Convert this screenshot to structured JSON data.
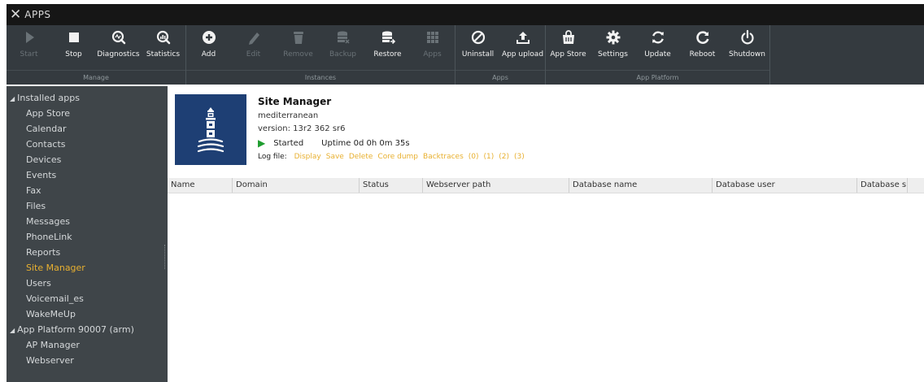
{
  "window": {
    "title": "APPS"
  },
  "toolbar": {
    "groups": [
      {
        "label": "Manage",
        "buttons": [
          {
            "label": "Start",
            "icon": "play-icon",
            "disabled": true
          },
          {
            "label": "Stop",
            "icon": "stop-icon",
            "disabled": false
          },
          {
            "label": "Diagnostics",
            "icon": "diagnostics-icon",
            "disabled": false
          },
          {
            "label": "Statistics",
            "icon": "statistics-icon",
            "disabled": false
          }
        ]
      },
      {
        "label": "Instances",
        "buttons": [
          {
            "label": "Add",
            "icon": "add-icon",
            "disabled": false
          },
          {
            "label": "Edit",
            "icon": "edit-icon",
            "disabled": true
          },
          {
            "label": "Remove",
            "icon": "trash-icon",
            "disabled": true
          },
          {
            "label": "Backup",
            "icon": "backup-icon",
            "disabled": true
          },
          {
            "label": "Restore",
            "icon": "restore-icon",
            "disabled": false
          },
          {
            "label": "Apps",
            "icon": "apps-grid-icon",
            "disabled": true
          }
        ]
      },
      {
        "label": "Apps",
        "buttons": [
          {
            "label": "Uninstall",
            "icon": "uninstall-icon",
            "disabled": false
          },
          {
            "label": "App upload",
            "icon": "upload-icon",
            "disabled": false
          }
        ]
      },
      {
        "label": "App Platform",
        "buttons": [
          {
            "label": "App Store",
            "icon": "store-icon",
            "disabled": false
          },
          {
            "label": "Settings",
            "icon": "gear-icon",
            "disabled": false
          },
          {
            "label": "Update",
            "icon": "update-icon",
            "disabled": false
          },
          {
            "label": "Reboot",
            "icon": "reboot-icon",
            "disabled": false
          },
          {
            "label": "Shutdown",
            "icon": "power-icon",
            "disabled": false
          }
        ]
      }
    ]
  },
  "sidebar": {
    "sections": [
      {
        "label": "Installed apps",
        "items": [
          {
            "label": "App Store",
            "active": false
          },
          {
            "label": "Calendar",
            "active": false
          },
          {
            "label": "Contacts",
            "active": false
          },
          {
            "label": "Devices",
            "active": false
          },
          {
            "label": "Events",
            "active": false
          },
          {
            "label": "Fax",
            "active": false
          },
          {
            "label": "Files",
            "active": false
          },
          {
            "label": "Messages",
            "active": false
          },
          {
            "label": "PhoneLink",
            "active": false
          },
          {
            "label": "Reports",
            "active": false
          },
          {
            "label": "Site Manager",
            "active": true
          },
          {
            "label": "Users",
            "active": false
          },
          {
            "label": "Voicemail_es",
            "active": false
          },
          {
            "label": "WakeMeUp",
            "active": false
          }
        ]
      },
      {
        "label": "App Platform 90007 (arm)",
        "items": [
          {
            "label": "AP Manager",
            "active": false
          },
          {
            "label": "Webserver",
            "active": false
          }
        ]
      }
    ]
  },
  "app": {
    "name": "Site Manager",
    "publisher": "mediterranean",
    "version": "version: 13r2 362 sr6",
    "status": "Started",
    "uptime": "Uptime 0d 0h 0m 35s",
    "logfile_label": "Log file:",
    "log_links": [
      "Display",
      "Save",
      "Delete",
      "Core dump",
      "Backtraces",
      "(0)",
      "(1)",
      "(2)",
      "(3)"
    ]
  },
  "table": {
    "columns": [
      "Name",
      "Domain",
      "Status",
      "Webserver path",
      "Database name",
      "Database user",
      "Database size"
    ]
  },
  "colors": {
    "accent": "#e8b030",
    "toolbar_bg": "#343a3f",
    "sidebar_bg": "#3f4549",
    "logo_bg": "#1e3f74",
    "started_green": "#1f9d2f"
  }
}
